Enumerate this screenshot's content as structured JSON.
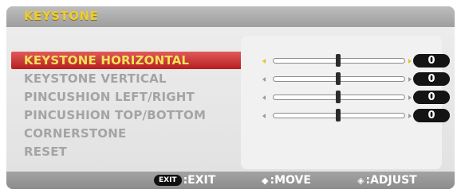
{
  "title": "KEYSTONE",
  "menu": {
    "items": [
      {
        "label": "KEYSTONE HORIZONTAL",
        "selected": true
      },
      {
        "label": "KEYSTONE VERTICAL",
        "selected": false
      },
      {
        "label": "PINCUSHION LEFT/RIGHT",
        "selected": false
      },
      {
        "label": "PINCUSHION TOP/BOTTOM",
        "selected": false
      },
      {
        "label": "CORNERSTONE",
        "selected": false
      },
      {
        "label": "RESET",
        "selected": false
      }
    ]
  },
  "sliders": [
    {
      "for": "KEYSTONE HORIZONTAL",
      "value": "0",
      "level": 0.5,
      "highlighted": true
    },
    {
      "for": "KEYSTONE VERTICAL",
      "value": "0",
      "level": 0.5,
      "highlighted": false
    },
    {
      "for": "PINCUSHION LEFT/RIGHT",
      "value": "0",
      "level": 0.5,
      "highlighted": false
    },
    {
      "for": "PINCUSHION TOP/BOTTOM",
      "value": "0",
      "level": 0.5,
      "highlighted": false
    }
  ],
  "footer": {
    "exit_badge": "EXIT",
    "exit_label": ":EXIT",
    "move_icon": "up-down-arrows",
    "move_label": ":MOVE",
    "adjust_icon": "left-right-arrows",
    "adjust_label": ":ADJUST"
  },
  "colors": {
    "title_text": "#f0cd2a",
    "selection_bar": "#c82a2a",
    "selection_text": "#f6e25a",
    "menu_text": "#a4a4a4",
    "value_box": "#141414"
  }
}
